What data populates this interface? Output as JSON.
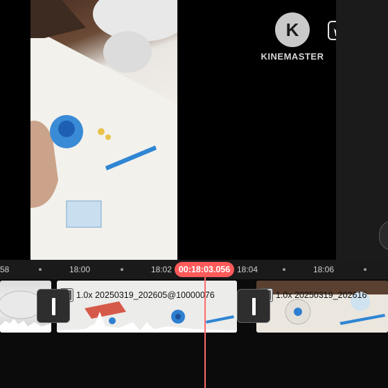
{
  "watermark": {
    "logo_letter": "K",
    "brand": "KINEMASTER"
  },
  "ruler": {
    "labels": [
      "58",
      "18:00",
      "18:02",
      "18:04",
      "18:06"
    ]
  },
  "playhead": {
    "time": "00:18:03.056"
  },
  "clips": [
    {
      "label": ""
    },
    {
      "label": "1.0x 20250319_202605@10000076"
    },
    {
      "label": "1.0x 20250319_202616"
    }
  ],
  "colors": {
    "accent": "#ff5a5a",
    "playhead_line": "#ff6b6b",
    "timeline_bg": "#0b0b0b",
    "ruler_bg": "#1a1a1a"
  },
  "icons": {
    "logo": "kinemaster-logo-icon",
    "premium": "crown-icon",
    "clip": "film-icon",
    "transition": "transition-icon"
  }
}
